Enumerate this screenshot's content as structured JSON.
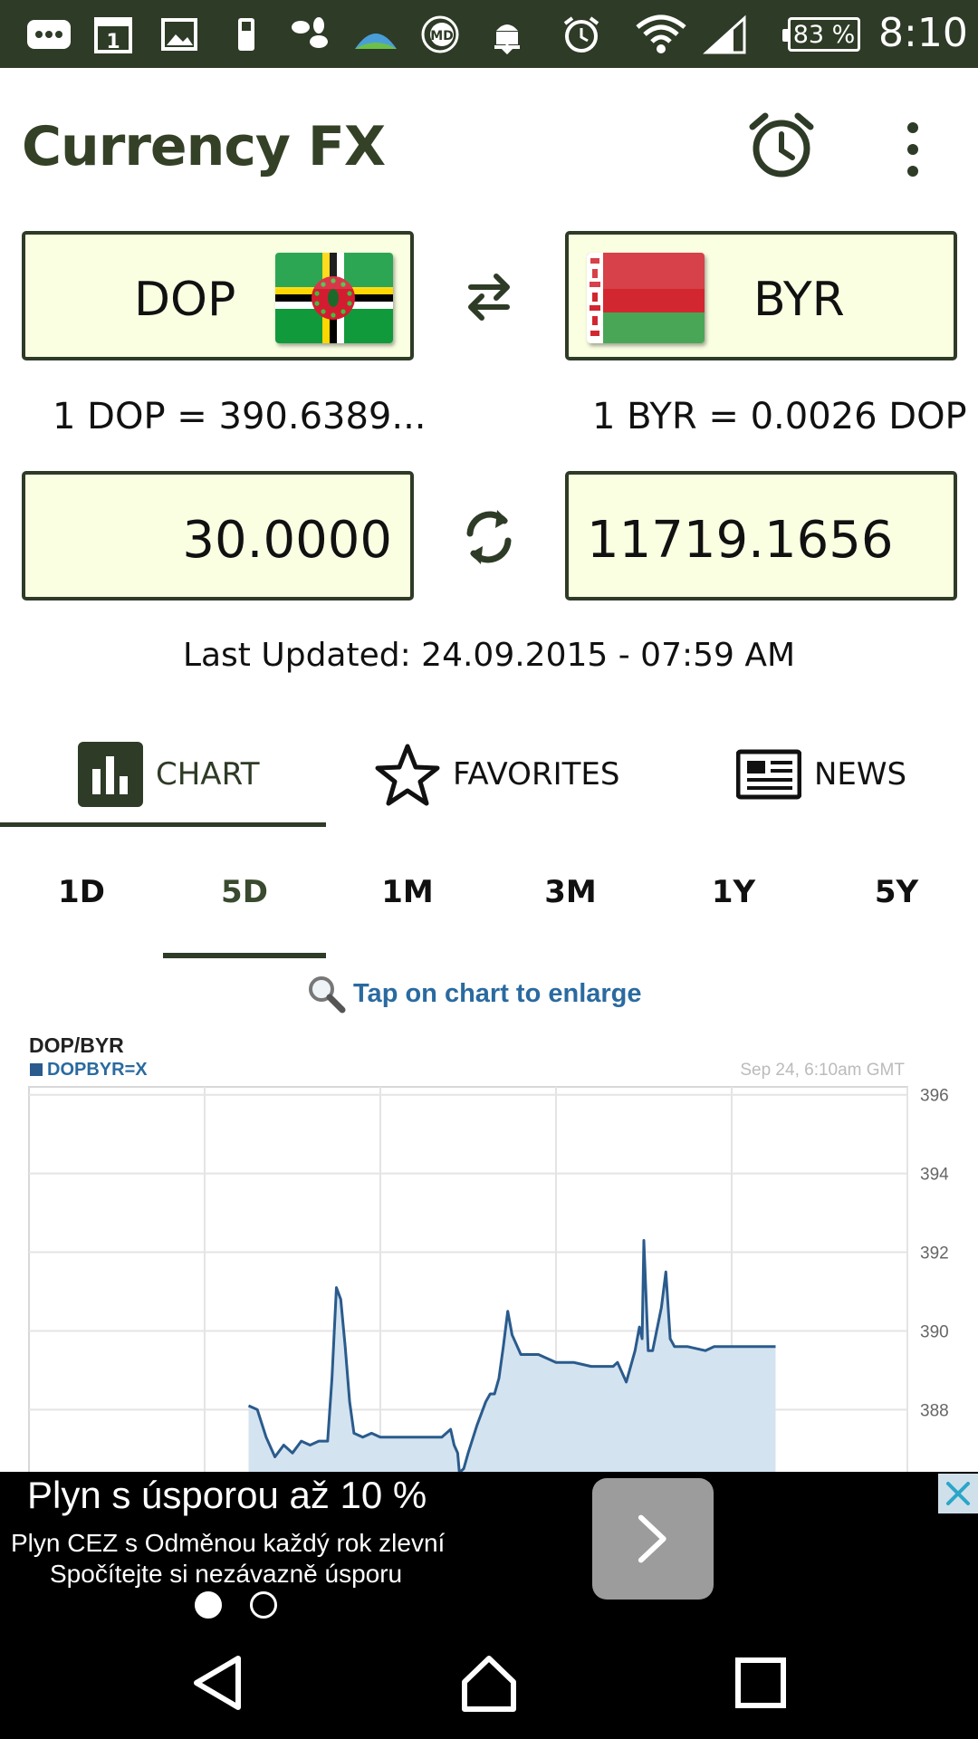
{
  "status_bar": {
    "battery": "83 %",
    "time": "8:10",
    "calendar_day": "1"
  },
  "app": {
    "title": "Currency FX"
  },
  "from_currency": {
    "code": "DOP",
    "flag": "dominica-flag",
    "rate": "1 DOP = 390.6389...",
    "amount": "30.0000"
  },
  "to_currency": {
    "code": "BYR",
    "flag": "belarus-flag",
    "rate": "1 BYR = 0.0026 DOP",
    "amount": "11719.1656"
  },
  "last_updated": "Last Updated: 24.09.2015 - 07:59 AM",
  "tabs": [
    {
      "label": "CHART",
      "icon": "bar-chart-icon",
      "active": true
    },
    {
      "label": "FAVORITES",
      "icon": "star-icon",
      "active": false
    },
    {
      "label": "NEWS",
      "icon": "newspaper-icon",
      "active": false
    }
  ],
  "periods": [
    "1D",
    "5D",
    "1M",
    "3M",
    "1Y",
    "5Y"
  ],
  "active_period": "5D",
  "enlarge_hint": "Tap on chart to enlarge",
  "chart_data": {
    "type": "area",
    "title": "DOP/BYR",
    "series": [
      {
        "name": "DOPBYR=X",
        "x": [
          0.25,
          0.26,
          0.27,
          0.28,
          0.29,
          0.3,
          0.31,
          0.32,
          0.33,
          0.34,
          0.345,
          0.35,
          0.355,
          0.36,
          0.365,
          0.37,
          0.38,
          0.39,
          0.4,
          0.42,
          0.44,
          0.46,
          0.47,
          0.48,
          0.484,
          0.488,
          0.49,
          0.495,
          0.5,
          0.51,
          0.52,
          0.525,
          0.53,
          0.535,
          0.54,
          0.545,
          0.55,
          0.56,
          0.58,
          0.59,
          0.6,
          0.62,
          0.64,
          0.66,
          0.665,
          0.67,
          0.68,
          0.69,
          0.695,
          0.698,
          0.7,
          0.705,
          0.71,
          0.72,
          0.725,
          0.73,
          0.735,
          0.74,
          0.75,
          0.77,
          0.78,
          0.8,
          0.82,
          0.85
        ],
        "values": [
          388.1,
          388.0,
          387.3,
          386.8,
          387.1,
          386.9,
          387.2,
          387.1,
          387.2,
          387.2,
          388.8,
          391.1,
          390.8,
          389.6,
          388.2,
          387.4,
          387.3,
          387.4,
          387.3,
          387.3,
          387.3,
          387.3,
          387.3,
          387.5,
          387.1,
          386.9,
          386.4,
          386.5,
          386.9,
          387.6,
          388.2,
          388.4,
          388.4,
          388.8,
          389.6,
          390.5,
          389.9,
          389.4,
          389.4,
          389.3,
          389.2,
          389.2,
          389.1,
          389.1,
          389.1,
          389.2,
          388.7,
          389.5,
          390.1,
          389.8,
          392.3,
          389.5,
          389.5,
          390.6,
          391.5,
          389.8,
          389.6,
          389.6,
          389.6,
          389.5,
          389.6,
          389.6,
          389.6,
          389.6
        ]
      }
    ],
    "timestamp": "Sep 24, 6:10am GMT",
    "y_ticks": [
      396,
      394,
      392,
      390,
      388
    ],
    "ylim": [
      385.5,
      396.2
    ],
    "grid": true,
    "colors": {
      "line": "#2a5b8c",
      "fill": "#d4e3f0"
    }
  },
  "ad": {
    "title": "Plyn s úsporou až 10 %",
    "line1": "Plyn CEZ s Odměnou každý rok zlevní",
    "line2": "Spočítejte si nezávazně úsporu"
  },
  "colors": {
    "primary": "#2e3b26",
    "box_bg": "#fbffe2",
    "link": "#2a6aa0"
  }
}
